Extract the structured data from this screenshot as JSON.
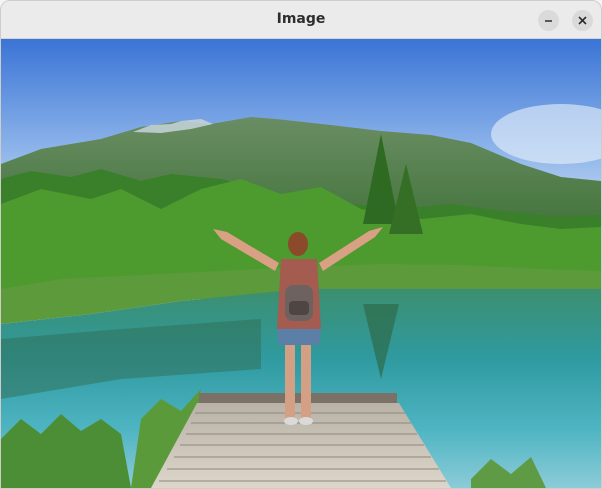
{
  "window": {
    "title": "Image",
    "controls": {
      "minimize_icon": "minimize-icon",
      "close_icon": "close-icon"
    }
  },
  "image": {
    "description_icon": "photo",
    "palette": {
      "sky_top": "#3f78d8",
      "sky_bottom": "#c9ddf3",
      "mountain": "#5c7f58",
      "forest": "#3f8f2c",
      "water": "#2f8f96",
      "dock": "#c9c1b4"
    }
  }
}
